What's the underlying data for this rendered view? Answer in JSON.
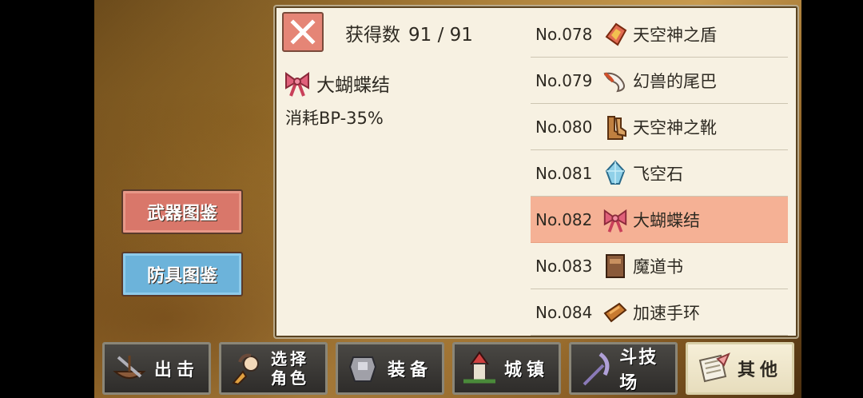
{
  "header": {
    "obtained_label": "获得数",
    "obtained_value": "91 / 91"
  },
  "detail": {
    "name": "大蝴蝶结",
    "effect": "消耗BP-35%",
    "icon": "ribbon-icon"
  },
  "items": [
    {
      "no": "No.078",
      "name": "天空神之盾",
      "icon": "shield-icon"
    },
    {
      "no": "No.079",
      "name": "幻兽的尾巴",
      "icon": "tail-icon"
    },
    {
      "no": "No.080",
      "name": "天空神之靴",
      "icon": "boots-icon"
    },
    {
      "no": "No.081",
      "name": "飞空石",
      "icon": "crystal-icon"
    },
    {
      "no": "No.082",
      "name": "大蝴蝶结",
      "icon": "ribbon-icon",
      "selected": true
    },
    {
      "no": "No.083",
      "name": "魔道书",
      "icon": "book-icon"
    },
    {
      "no": "No.084",
      "name": "加速手环",
      "icon": "bracelet-icon"
    }
  ],
  "side_buttons": {
    "weapon": "武器图鉴",
    "armor": "防具图鉴"
  },
  "nav": {
    "sortie": "出击",
    "select_char_line1": "选择",
    "select_char_line2": "角色",
    "equip": "装备",
    "town": "城镇",
    "arena": "斗技场",
    "other": "其他"
  },
  "colors": {
    "selected_row": "#f5b195",
    "weapon_button": "#d9776a",
    "armor_button": "#6cb3da",
    "close_button": "#e58576"
  }
}
